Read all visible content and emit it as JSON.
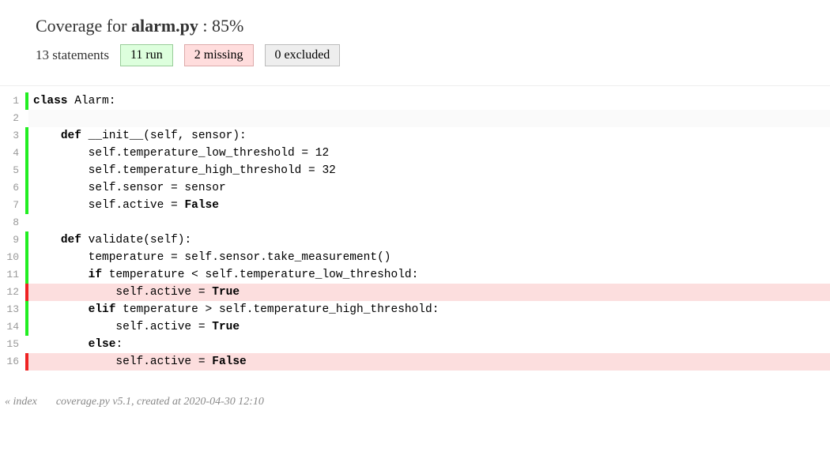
{
  "header": {
    "prefix": "Coverage for ",
    "file": "alarm.py",
    "separator": " : ",
    "percent": "85%",
    "statements": "13 statements",
    "run": "11 run",
    "missing": "2 missing",
    "excluded": "0 excluded"
  },
  "lines": [
    {
      "n": "1",
      "status": "run",
      "tokens": [
        {
          "k": "kw",
          "t": "class"
        },
        {
          "t": " Alarm:"
        }
      ]
    },
    {
      "n": "2",
      "status": "empty",
      "tokens": []
    },
    {
      "n": "3",
      "status": "run",
      "tokens": [
        {
          "t": "    "
        },
        {
          "k": "kw",
          "t": "def"
        },
        {
          "t": " __init__(self, sensor):"
        }
      ]
    },
    {
      "n": "4",
      "status": "run",
      "tokens": [
        {
          "t": "        self.temperature_low_threshold = 12"
        }
      ]
    },
    {
      "n": "5",
      "status": "run",
      "tokens": [
        {
          "t": "        self.temperature_high_threshold = 32"
        }
      ]
    },
    {
      "n": "6",
      "status": "run",
      "tokens": [
        {
          "t": "        self.sensor = sensor"
        }
      ]
    },
    {
      "n": "7",
      "status": "run",
      "tokens": [
        {
          "t": "        self.active = "
        },
        {
          "k": "bool",
          "t": "False"
        }
      ]
    },
    {
      "n": "8",
      "status": "none",
      "tokens": []
    },
    {
      "n": "9",
      "status": "run",
      "tokens": [
        {
          "t": "    "
        },
        {
          "k": "kw",
          "t": "def"
        },
        {
          "t": " validate(self):"
        }
      ]
    },
    {
      "n": "10",
      "status": "run",
      "tokens": [
        {
          "t": "        temperature = self.sensor.take_measurement()"
        }
      ]
    },
    {
      "n": "11",
      "status": "run",
      "tokens": [
        {
          "t": "        "
        },
        {
          "k": "kw",
          "t": "if"
        },
        {
          "t": " temperature < self.temperature_low_threshold:"
        }
      ]
    },
    {
      "n": "12",
      "status": "miss",
      "tokens": [
        {
          "t": "            self.active = "
        },
        {
          "k": "bool",
          "t": "True"
        }
      ]
    },
    {
      "n": "13",
      "status": "run",
      "tokens": [
        {
          "t": "        "
        },
        {
          "k": "kw",
          "t": "elif"
        },
        {
          "t": " temperature > self.temperature_high_threshold:"
        }
      ]
    },
    {
      "n": "14",
      "status": "run",
      "tokens": [
        {
          "t": "            self.active = "
        },
        {
          "k": "bool",
          "t": "True"
        }
      ]
    },
    {
      "n": "15",
      "status": "none",
      "tokens": [
        {
          "t": "        "
        },
        {
          "k": "kw",
          "t": "else"
        },
        {
          "t": ":"
        }
      ]
    },
    {
      "n": "16",
      "status": "miss",
      "tokens": [
        {
          "t": "            self.active = "
        },
        {
          "k": "bool",
          "t": "False"
        }
      ]
    }
  ],
  "footer": {
    "index": "« index",
    "note": "coverage.py v5.1, created at 2020-04-30 12:10"
  }
}
